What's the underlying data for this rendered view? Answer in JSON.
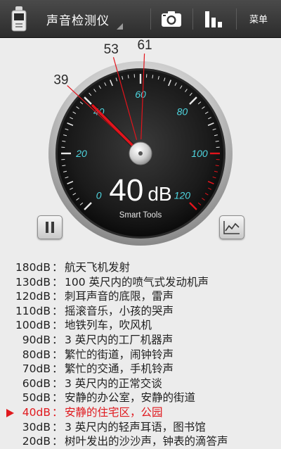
{
  "app": {
    "title": "声音检测仪",
    "menu_label": "菜单",
    "icons": [
      "sound-meter-icon",
      "camera-icon",
      "bar-chart-icon"
    ]
  },
  "gauge": {
    "scale_min": 0,
    "scale_max": 120,
    "ticks": [
      "0",
      "20",
      "40",
      "60",
      "80",
      "100",
      "120"
    ],
    "markers": [
      "39",
      "53",
      "61"
    ],
    "needle_value": 40,
    "reading": "40",
    "unit": "dB",
    "brand": "Smart Tools",
    "colors": {
      "tick_label": "#4fd6e0",
      "needle": "#e3141c",
      "red_zone": "#e3141c",
      "marker_line": "#e3141c"
    }
  },
  "controls": {
    "pause_icon": "pause-icon",
    "graph_icon": "line-graph-icon"
  },
  "reference_list": {
    "active_index": 10,
    "rows": [
      {
        "level": "180dB",
        "desc": "航天飞机发射"
      },
      {
        "level": "130dB",
        "desc": "100 英尺内的喷气式发动机声"
      },
      {
        "level": "120dB",
        "desc": "刺耳声音的底限，雷声"
      },
      {
        "level": "110dB",
        "desc": "摇滚音乐，小孩的哭声"
      },
      {
        "level": "100dB",
        "desc": "地铁列车，吹风机"
      },
      {
        "level": "90dB",
        "desc": "3 英尺内的工厂机器声"
      },
      {
        "level": "80dB",
        "desc": "繁忙的街道，闹钟铃声"
      },
      {
        "level": "70dB",
        "desc": "繁忙的交通，手机铃声"
      },
      {
        "level": "60dB",
        "desc": "3 英尺内的正常交谈"
      },
      {
        "level": "50dB",
        "desc": "安静的办公室，安静的街道"
      },
      {
        "level": "40dB",
        "desc": "安静的住宅区，公园"
      },
      {
        "level": "30dB",
        "desc": "3 英尺内的轻声耳语，图书馆"
      },
      {
        "level": "20dB",
        "desc": "树叶发出的沙沙声，钟表的滴答声"
      }
    ]
  }
}
